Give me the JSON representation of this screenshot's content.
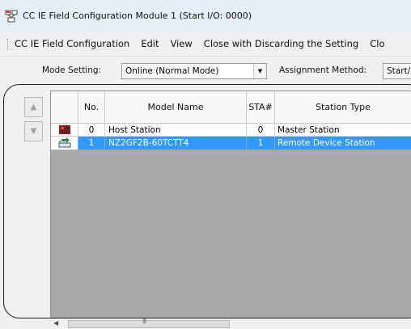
{
  "window": {
    "title": "CC IE Field Configuration Module 1 (Start I/O: 0000)",
    "icon": "network-config-icon"
  },
  "menu": {
    "items": [
      {
        "label": "CC IE Field Configuration"
      },
      {
        "label": "Edit"
      },
      {
        "label": "View"
      },
      {
        "label": "Close with Discarding the Setting"
      },
      {
        "label": "Clo"
      }
    ]
  },
  "toolbar": {
    "mode_label": "Mode Setting:",
    "mode_value": "Online (Normal Mode)",
    "assignment_label": "Assignment Method:",
    "assignment_value": "Start/"
  },
  "nav": {
    "up_icon": "triangle-up-icon",
    "down_icon": "triangle-down-icon"
  },
  "table": {
    "columns": [
      "No.",
      "Model Name",
      "STA#",
      "Station Type"
    ],
    "rows": [
      {
        "icon": "master-station-icon",
        "no": "0",
        "model": "Host Station",
        "sta": "0",
        "type": "Master Station",
        "selected": false
      },
      {
        "icon": "remote-device-icon",
        "no": "1",
        "model": "NZ2GF2B-60TCTT4",
        "sta": "1",
        "type": "Remote Device Station",
        "selected": true
      }
    ]
  },
  "scrollbar": {
    "grip": "III"
  },
  "colors": {
    "selection": "#3399ff",
    "empty_area": "#a9a9a9"
  }
}
